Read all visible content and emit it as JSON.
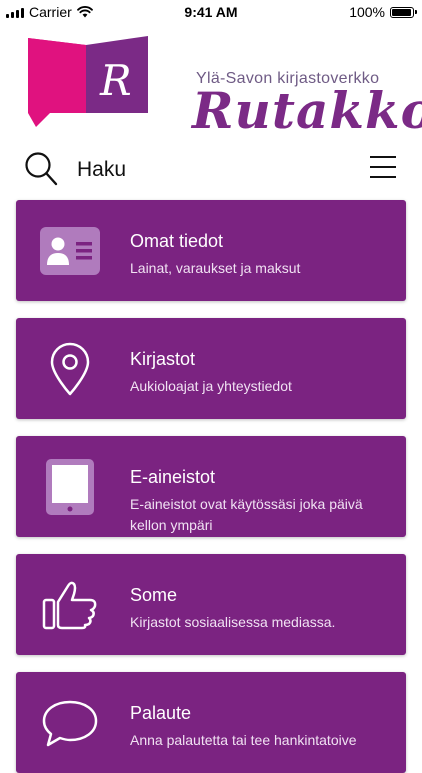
{
  "status_bar": {
    "carrier": "Carrier",
    "time": "9:41 AM",
    "battery_percent": "100%",
    "battery_level": 1.0
  },
  "logo": {
    "tagline": "Ylä-Savon kirjastoverkko",
    "name": "Rutakko",
    "letter": "R",
    "colors": {
      "magenta": "#e0127f",
      "purple": "#7b2a86"
    }
  },
  "search": {
    "label": "Haku",
    "icon": "search-icon",
    "menu_icon": "hamburger-menu-icon"
  },
  "theme": {
    "card_background": "#7b2381",
    "card_text": "#ffffff"
  },
  "menu_items": [
    {
      "title": "Omat tiedot",
      "subtitle": "Lainat, varaukset ja maksut",
      "icon": "id-card-icon"
    },
    {
      "title": "Kirjastot",
      "subtitle": "Aukioloajat ja yhteystiedot",
      "icon": "location-pin-icon"
    },
    {
      "title": "E-aineistot",
      "subtitle": "E-aineistot ovat käytössäsi joka päivä kellon ympäri",
      "icon": "tablet-icon"
    },
    {
      "title": "Some",
      "subtitle": "Kirjastot sosiaalisessa mediassa.",
      "icon": "thumbs-up-icon"
    },
    {
      "title": "Palaute",
      "subtitle": "Anna palautetta tai tee hankintatoive",
      "icon": "speech-bubble-icon"
    }
  ]
}
